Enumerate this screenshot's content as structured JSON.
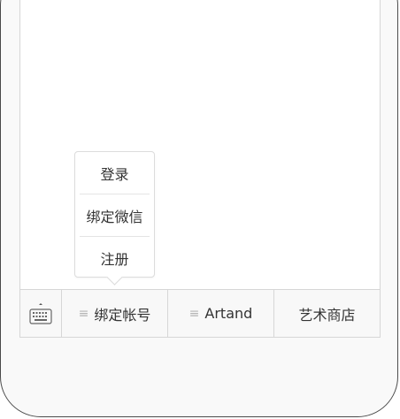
{
  "colors": {
    "frame": "#4a4a4a",
    "menu_bar_bg": "#f8f8f8",
    "text": "#333333",
    "hamburger": "#b5b5b5",
    "divider": "#d6d6d6"
  },
  "menu_bar": {
    "keyboard_icon": "keyboard-icon",
    "items": [
      {
        "label": "绑定帐号",
        "has_submenu": true,
        "icon": "hamburger-icon"
      },
      {
        "label": "Artand",
        "has_submenu": true,
        "icon": "hamburger-icon"
      },
      {
        "label": "艺术商店",
        "has_submenu": false
      }
    ]
  },
  "popup": {
    "items": [
      {
        "label": "登录"
      },
      {
        "label": "绑定微信"
      },
      {
        "label": "注册"
      }
    ]
  }
}
